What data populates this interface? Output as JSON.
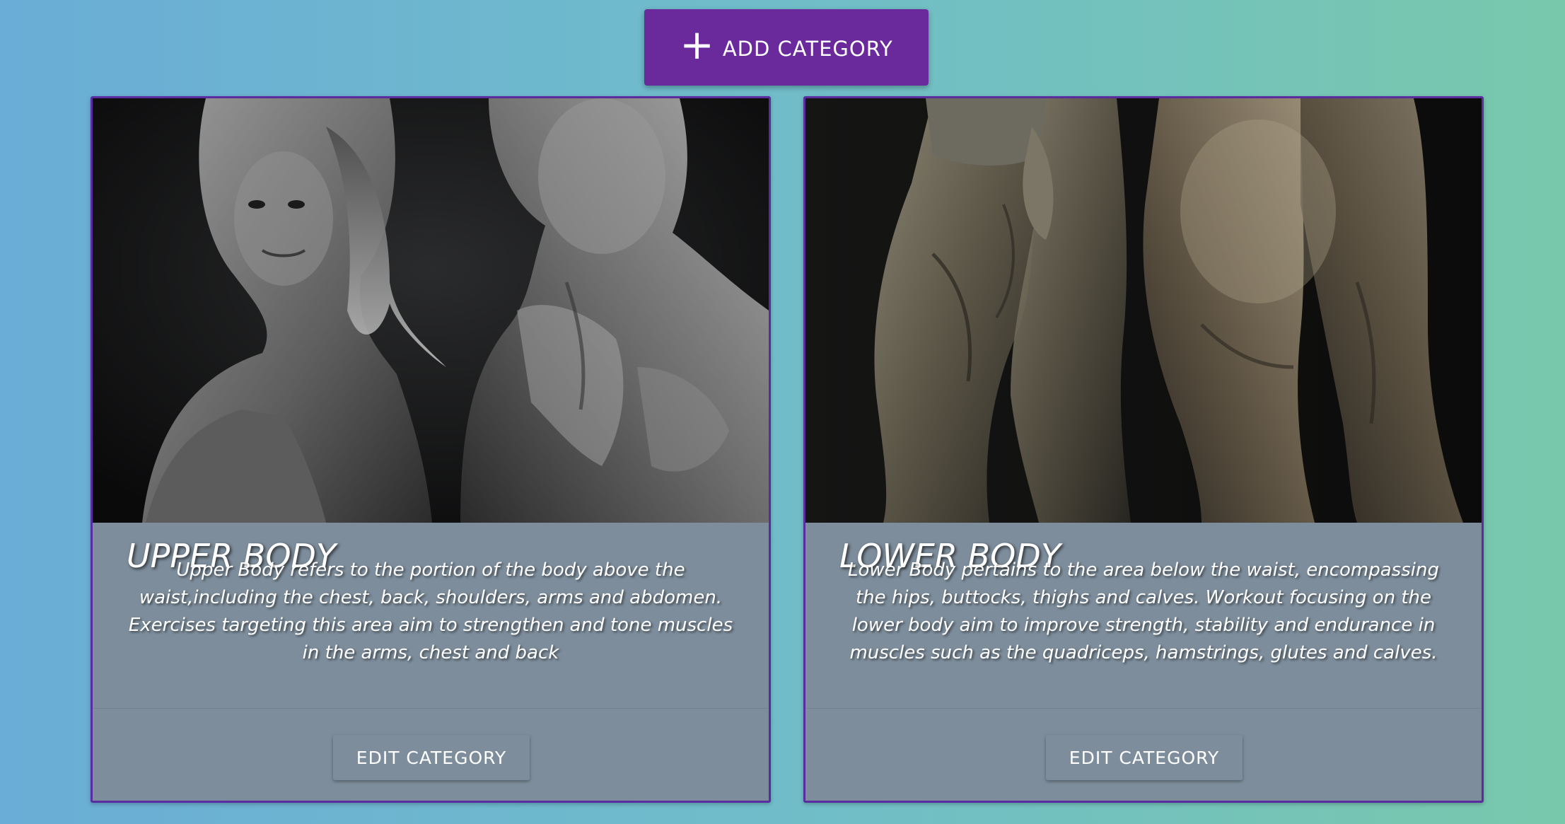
{
  "toolbar": {
    "add_label": "ADD CATEGORY",
    "add_icon": "plus-icon"
  },
  "colors": {
    "accent": "#6a2a9c",
    "card_border": "#5b2ba0",
    "card_body": "#7d8d9b",
    "background_left": "#6aadd6",
    "background_right": "#78c8ac"
  },
  "categories": [
    {
      "title": "UPPER BODY",
      "description": "Upper Body refers to the portion of the body above the waist,including the chest, back, shoulders, arms and abdomen. Exercises targeting this area aim to strengthen and tone muscles in the arms, chest and back",
      "edit_label": "EDIT CATEGORY",
      "image": "upper-body-photo"
    },
    {
      "title": "LOWER BODY",
      "description": "Lower Body pertains to the area below the waist, encompassing the hips, buttocks, thighs and calves. Workout focusing on the lower body aim to improve strength, stability and endurance in muscles such as the quadriceps, hamstrings, glutes and calves.",
      "edit_label": "EDIT CATEGORY",
      "image": "lower-body-photo"
    }
  ]
}
